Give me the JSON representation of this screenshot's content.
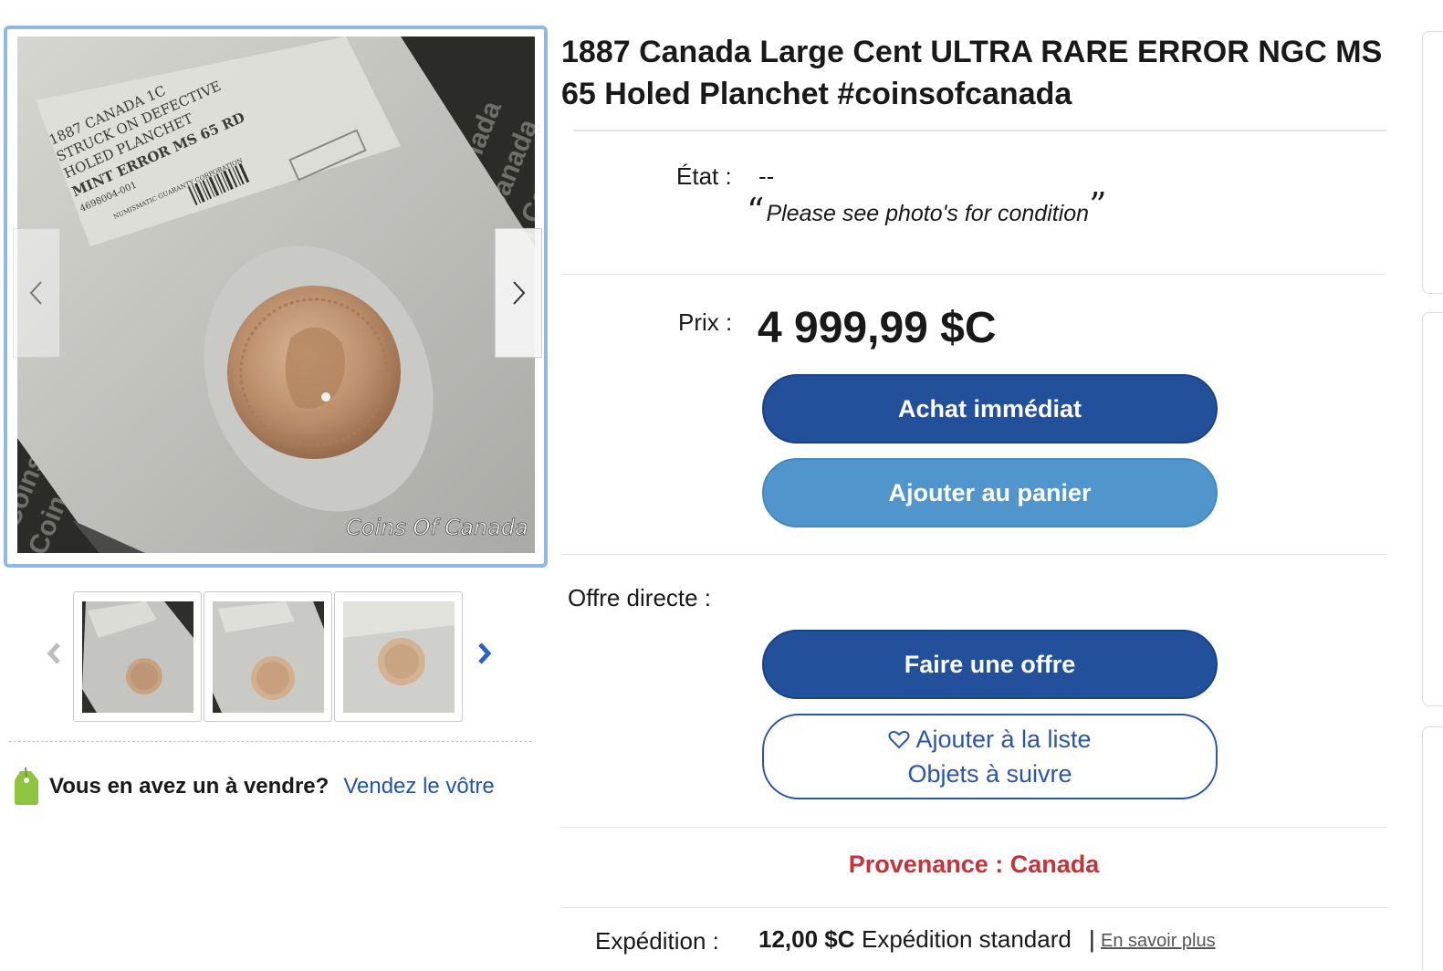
{
  "listing": {
    "title": "1887 Canada Large Cent ULTRA RARE ERROR NGC MS 65 Holed Planchet #coinsofcanada"
  },
  "gallery": {
    "main_image": {
      "slab_label_lines": [
        "1887 CANADA 1C",
        "STRUCK ON DEFECTIVE",
        "HOLED PLANCHET",
        "MINT ERROR MS 65 RD",
        "4698004-001"
      ],
      "slab_small_text": "NUMISMATIC GUARANTY CORPORATION",
      "watermark": "Coins Of Canada",
      "background_text": "Coins Of Canada"
    },
    "thumbnail_count": 3
  },
  "sell_prompt": {
    "question": "Vous en avez un à vendre?",
    "link": "Vendez le vôtre"
  },
  "condition": {
    "label": "État :",
    "value": "--",
    "note": "Please see photo's for condition",
    "quote_open": "“",
    "quote_close": "”"
  },
  "price": {
    "label": "Prix :",
    "value": "4 999,99 $C"
  },
  "buttons": {
    "buy_now": "Achat immédiat",
    "add_to_cart": "Ajouter au panier",
    "make_offer": "Faire une offre",
    "watchlist_line1": "Ajouter à la liste",
    "watchlist_line2": "Objets à suivre"
  },
  "best_offer": {
    "label": "Offre directe :"
  },
  "provenance": {
    "text": "Provenance : Canada"
  },
  "shipping": {
    "label": "Expédition :",
    "price": "12,00 $C",
    "method": "Expédition standard",
    "separator": "|",
    "more_link": "En savoir plus"
  },
  "colors": {
    "primary_button": "#22509a",
    "secondary_button": "#5095cc",
    "link": "#2355a6",
    "provenance": "#c4323a",
    "gallery_border": "#8fb8ea"
  },
  "icons": [
    "chevron-left-icon",
    "chevron-right-icon",
    "price-tag-icon",
    "heart-icon"
  ]
}
